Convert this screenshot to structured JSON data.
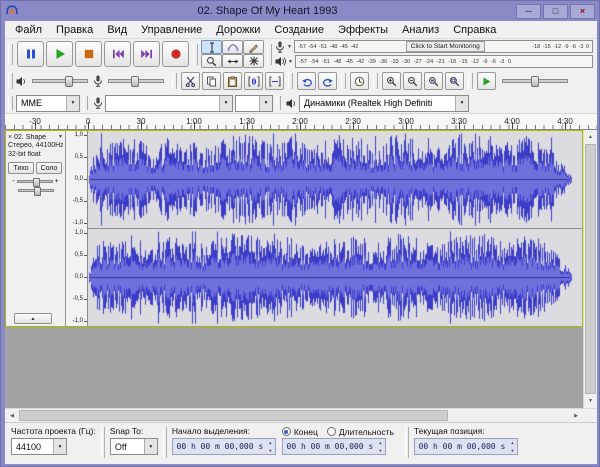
{
  "colors": {
    "titlebar": "#8a8ac6",
    "pause_blue": "#2a4fd0",
    "play_green": "#28a428",
    "stop_orange": "#c8690f",
    "skip_purple": "#7a3fa8",
    "record_red": "#cc2a2a",
    "waveform_peak": "#3c3cc8",
    "waveform_rms": "#7070dc",
    "track_focus_border": "#b5b500"
  },
  "window": {
    "title": "02. Shape Of My Heart 1993"
  },
  "icons": {
    "minimize": "─",
    "maximize": "□",
    "close": "×",
    "dropdown": "▼",
    "up": "▲",
    "down": "▼",
    "left": "◀",
    "right": "▶",
    "collapse": "▲",
    "track_close": "×"
  },
  "menu": {
    "items": [
      "Файл",
      "Правка",
      "Вид",
      "Управление",
      "Дорожки",
      "Создание",
      "Эффекты",
      "Анализ",
      "Справка"
    ]
  },
  "meters": {
    "record_ticks_left": [
      "-57",
      "-54",
      "-51",
      "-48",
      "-45",
      "-42"
    ],
    "monitor_button": "Click to Start Monitoring",
    "record_ticks_right": [
      "-18",
      "-15",
      "-12",
      "-9",
      "-6",
      "-3",
      "0"
    ],
    "play_ticks": [
      "-57",
      "-54",
      "-51",
      "-48",
      "-45",
      "-42",
      "-39",
      "-36",
      "-33",
      "-30",
      "-27",
      "-24",
      "-21",
      "-18",
      "-15",
      "-12",
      "-9",
      "-6",
      "-3",
      "0"
    ]
  },
  "device": {
    "host": "MME",
    "input": "",
    "channels": "",
    "output": "Динамики (Realtek High Definiti"
  },
  "timeline": {
    "ticks": [
      "-30",
      "0",
      "30",
      "1:00",
      "1:30",
      "2:00",
      "2:30",
      "3:00",
      "3:30",
      "4:00",
      "4:30"
    ]
  },
  "track": {
    "name": "02. Shape",
    "info1": "Стерео, 44100Hz",
    "info2": "32-bit float",
    "mute": "Тихо",
    "solo": "Соло",
    "gain_min": "-",
    "gain_max": "+",
    "ruler": [
      "1,0",
      "0,5",
      "0,0",
      "-0,5",
      "-1,0"
    ]
  },
  "status": {
    "rate_label": "Частота проекта (Гц):",
    "rate_value": "44100",
    "snap_label": "Snap To:",
    "snap_value": "Off",
    "sel_start_label": "Начало выделения:",
    "radio_end": "Конец",
    "radio_length": "Длительность",
    "position_label": "Текущая позиция:",
    "time_value": "00 h 00 m 00,000 s"
  },
  "waveform": {
    "seed": 982451,
    "start": 1,
    "end": 483,
    "bg": "#dcdce0",
    "peak": "#3c3cc8",
    "rms": "#7070dc",
    "center": "#30309a",
    "breakpoints": [
      [
        0,
        0.08
      ],
      [
        0.008,
        0.45
      ],
      [
        0.02,
        0.72
      ],
      [
        0.06,
        0.8
      ],
      [
        0.1,
        0.86
      ],
      [
        0.13,
        0.55
      ],
      [
        0.16,
        0.82
      ],
      [
        0.2,
        0.88
      ],
      [
        0.24,
        0.62
      ],
      [
        0.28,
        0.85
      ],
      [
        0.33,
        0.9
      ],
      [
        0.38,
        0.7
      ],
      [
        0.42,
        0.88
      ],
      [
        0.46,
        0.62
      ],
      [
        0.5,
        0.86
      ],
      [
        0.55,
        0.9
      ],
      [
        0.59,
        0.65
      ],
      [
        0.63,
        0.88
      ],
      [
        0.68,
        0.8
      ],
      [
        0.72,
        0.6
      ],
      [
        0.76,
        0.88
      ],
      [
        0.82,
        0.9
      ],
      [
        0.87,
        0.75
      ],
      [
        0.92,
        0.85
      ],
      [
        0.96,
        0.6
      ],
      [
        0.985,
        0.3
      ],
      [
        1,
        0.12
      ]
    ]
  }
}
